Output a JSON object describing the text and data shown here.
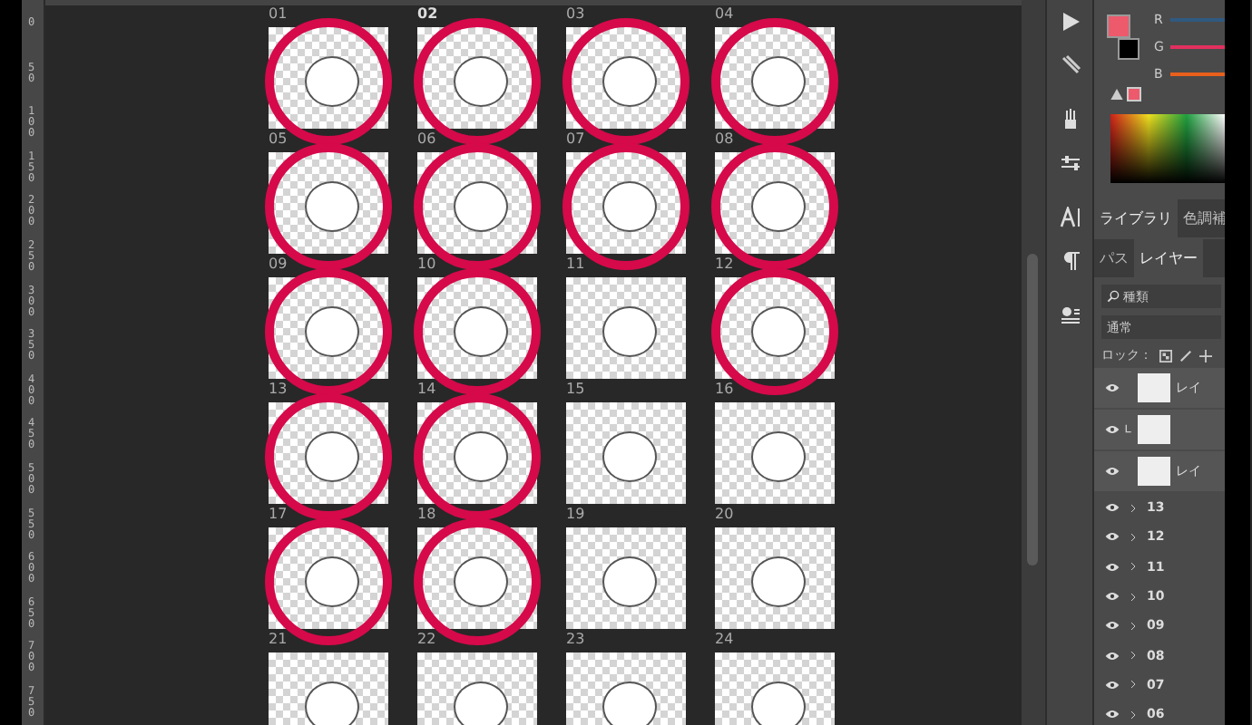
{
  "ruler": {
    "labels": [
      "0",
      "50",
      "100",
      "150",
      "200",
      "250",
      "300",
      "350",
      "400",
      "450",
      "500",
      "550",
      "600",
      "650",
      "700",
      "750"
    ]
  },
  "canvas": {
    "stickers": [
      {
        "label": "01",
        "circled": true
      },
      {
        "label": "02",
        "circled": true
      },
      {
        "label": "03",
        "circled": true
      },
      {
        "label": "04",
        "circled": true
      },
      {
        "label": "05",
        "circled": true
      },
      {
        "label": "06",
        "circled": true
      },
      {
        "label": "07",
        "circled": true
      },
      {
        "label": "08",
        "circled": true
      },
      {
        "label": "09",
        "circled": true
      },
      {
        "label": "10",
        "circled": true
      },
      {
        "label": "11",
        "circled": false
      },
      {
        "label": "12",
        "circled": true
      },
      {
        "label": "13",
        "circled": true
      },
      {
        "label": "14",
        "circled": true
      },
      {
        "label": "15",
        "circled": false
      },
      {
        "label": "16",
        "circled": false
      },
      {
        "label": "17",
        "circled": true
      },
      {
        "label": "18",
        "circled": true
      },
      {
        "label": "19",
        "circled": false
      },
      {
        "label": "20",
        "circled": false
      },
      {
        "label": "21",
        "circled": false
      },
      {
        "label": "22",
        "circled": false
      },
      {
        "label": "23",
        "circled": false
      },
      {
        "label": "24",
        "circled": false
      }
    ]
  },
  "color_panel": {
    "channels": [
      {
        "label": "R",
        "color": "#2f5a80"
      },
      {
        "label": "G",
        "color": "#e0305e"
      },
      {
        "label": "B",
        "color": "#e8601c"
      }
    ]
  },
  "panel_tabs": [
    {
      "label": "ライブラリ",
      "selected": true
    },
    {
      "label": "色調補",
      "selected": false
    }
  ],
  "layer_tabs": [
    {
      "label": "パス",
      "selected": false
    },
    {
      "label": "レイヤー",
      "selected": true
    }
  ],
  "layers_panel": {
    "filter": "種類",
    "blend_mode": "通常",
    "lock_label": "ロック：",
    "layers": [
      {
        "name": "レイ",
        "visible": true,
        "clipped": false
      },
      {
        "visible": true,
        "clipped": true
      },
      {
        "name": "レイ",
        "visible": true,
        "clipped": false
      }
    ],
    "groups": [
      {
        "name": "13",
        "visible": true,
        "expanded": false
      },
      {
        "name": "12",
        "visible": true,
        "expanded": false
      },
      {
        "name": "11",
        "visible": true,
        "expanded": false
      },
      {
        "name": "10",
        "visible": true,
        "expanded": false
      },
      {
        "name": "09",
        "visible": true,
        "expanded": false
      },
      {
        "name": "08",
        "visible": true,
        "expanded": false
      },
      {
        "name": "07",
        "visible": true,
        "expanded": false
      },
      {
        "name": "06",
        "visible": true,
        "expanded": false
      }
    ]
  }
}
